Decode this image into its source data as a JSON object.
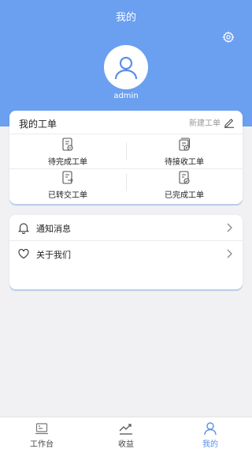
{
  "header": {
    "title": "我的",
    "username": "admin",
    "settings_icon": "gear-icon",
    "bg_color": "#6b9ff0"
  },
  "orders": {
    "title": "我的工单",
    "new_label": "新建工单",
    "items": [
      {
        "label": "待完成工单",
        "icon": "pending-document-icon"
      },
      {
        "label": "待接收工单",
        "icon": "receive-document-icon"
      },
      {
        "label": "已转交工单",
        "icon": "transfer-document-icon"
      },
      {
        "label": "已完成工单",
        "icon": "completed-document-icon"
      }
    ]
  },
  "menu": {
    "items": [
      {
        "label": "通知消息",
        "icon": "bell-icon"
      },
      {
        "label": "关于我们",
        "icon": "heart-icon"
      }
    ]
  },
  "tabbar": {
    "tabs": [
      {
        "label": "工作台",
        "icon": "workbench-icon",
        "active": false
      },
      {
        "label": "收益",
        "icon": "trend-chart-icon",
        "active": false
      },
      {
        "label": "我的",
        "icon": "user-icon",
        "active": true
      }
    ],
    "active_color": "#5b8fe6"
  }
}
